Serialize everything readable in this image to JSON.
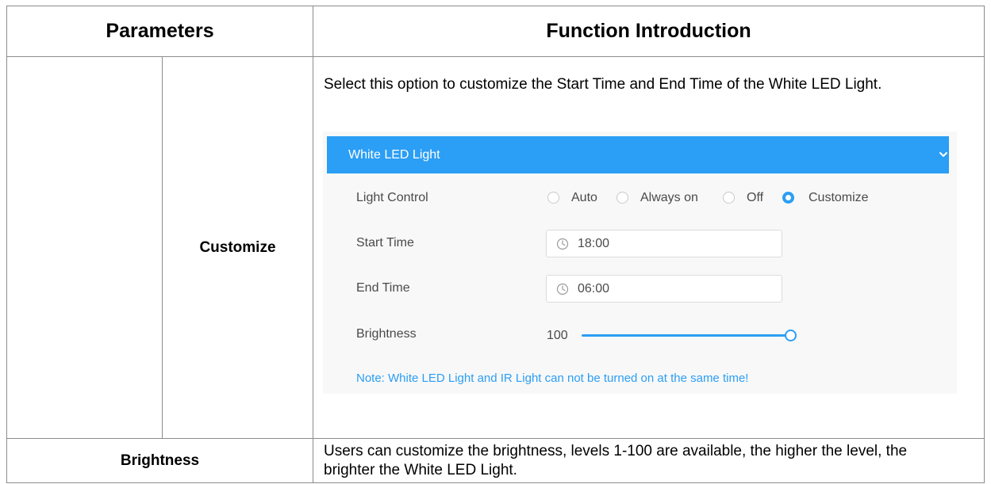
{
  "table": {
    "col_parameters": "Parameters",
    "col_function": "Function Introduction",
    "rows": [
      {
        "param": "Customize",
        "description": "Select this option to customize the Start Time and End Time of the White LED Light."
      },
      {
        "param": "Brightness",
        "description": "Users can customize the brightness, levels 1-100 are available, the higher the level, the brighter the White LED Light."
      }
    ]
  },
  "panel": {
    "title": "White LED Light",
    "header_color": "#2b9ef5",
    "expand_icon": "chevron-down-icon",
    "light_control": {
      "label": "Light Control",
      "options": [
        "Auto",
        "Always on",
        "Off",
        "Customize"
      ],
      "selected": "Customize"
    },
    "start_time": {
      "label": "Start Time",
      "value": "18:00",
      "icon": "clock-icon"
    },
    "end_time": {
      "label": "End Time",
      "value": "06:00",
      "icon": "clock-icon"
    },
    "brightness": {
      "label": "Brightness",
      "value": "100",
      "level_fraction": 1.0
    },
    "note": "Note: White LED Light and IR Light can not be turned on at the same time!"
  }
}
